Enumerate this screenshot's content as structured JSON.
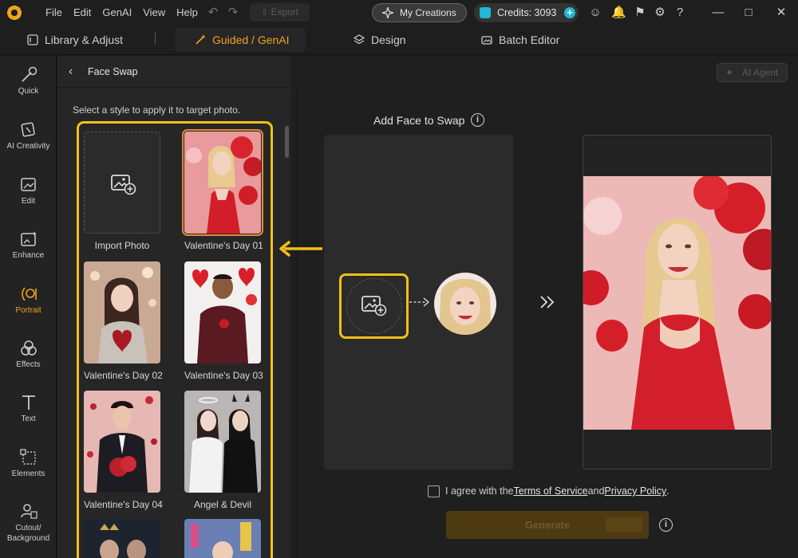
{
  "menu": [
    "File",
    "Edit",
    "GenAI",
    "View",
    "Help"
  ],
  "toolbar": {
    "export_label": "Export"
  },
  "header": {
    "my_creations_label": "My Creations",
    "credits_label": "Credits: 3093"
  },
  "nav": {
    "tabs": [
      "Library & Adjust",
      "Guided / GenAI",
      "Design",
      "Batch Editor"
    ],
    "active_index": 1
  },
  "rail": {
    "items": [
      "Quick",
      "AI Creativity",
      "Edit",
      "Enhance",
      "Portrait",
      "Effects",
      "Text",
      "Elements",
      "Cutout/\nBackground"
    ],
    "active": "Portrait"
  },
  "panel": {
    "title": "Face Swap",
    "hint": "Select a style to apply it to target photo.",
    "tiles": [
      {
        "label": "Import Photo",
        "kind": "import"
      },
      {
        "label": "Valentine's Day 01",
        "kind": "photo",
        "selected": true
      },
      {
        "label": "Valentine's Day 02",
        "kind": "photo"
      },
      {
        "label": "Valentine's Day 03",
        "kind": "photo"
      },
      {
        "label": "Valentine's Day 04",
        "kind": "photo"
      },
      {
        "label": "Angel & Devil",
        "kind": "photo"
      }
    ]
  },
  "main": {
    "ai_agent_label": "AI Agent",
    "add_face_title": "Add Face to Swap",
    "agree": {
      "prefix": "I agree with the ",
      "terms": "Terms of Service",
      "and": " and ",
      "privacy": "Privacy Policy",
      "suffix": "."
    },
    "generate_label": "Generate"
  },
  "colors": {
    "accent": "#f0a41c",
    "highlight": "#f4c01a",
    "credits": "#1fb8d6",
    "background": "#1b1b1b"
  }
}
